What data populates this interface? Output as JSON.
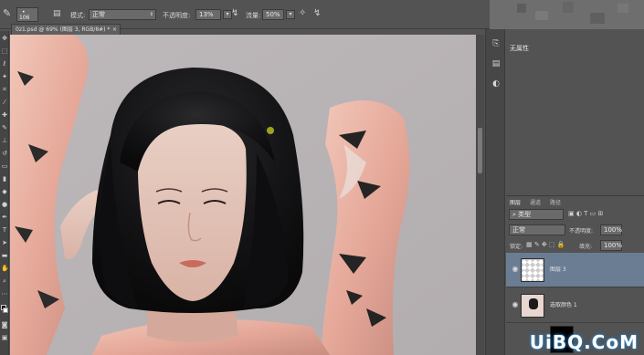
{
  "options_bar": {
    "brush_size": "106",
    "mode_label": "模式:",
    "mode_value": "正常",
    "opacity_label": "不透明度:",
    "opacity_value": "13%",
    "flow_label": "流量:",
    "flow_value": "50%"
  },
  "document": {
    "tab_title": "0z1.psd @ 69% (图层 3, RGB/8#) *",
    "close_glyph": "×"
  },
  "properties": {
    "title": "无属性"
  },
  "layers_panel": {
    "tabs": [
      "图层",
      "通道",
      "路径"
    ],
    "filter_kind": "类型",
    "blend_mode": "正常",
    "opacity_label": "不透明度:",
    "opacity_value": "100%",
    "lock_label": "锁定:",
    "fill_label": "填充:",
    "fill_value": "100%",
    "layers": [
      {
        "name": "图层 3",
        "selected": true
      },
      {
        "name": "选取颜色 1",
        "selected": false
      }
    ]
  },
  "watermark": "UiBQ.CoM",
  "colors": {
    "accent_selected": "#6a7d93",
    "panel_bg": "#535353",
    "canvas_bg": "#b9b4b5"
  }
}
